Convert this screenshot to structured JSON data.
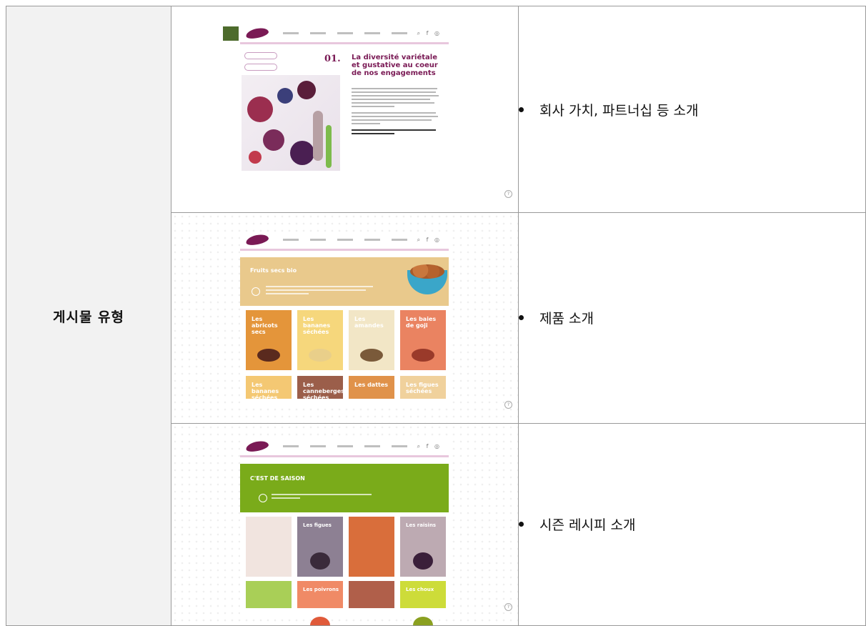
{
  "table": {
    "category_label": "게시물 유형",
    "rows": [
      {
        "description": "회사 가치, 파트너십 등 소개",
        "screenshot": {
          "number": "01.",
          "heading": "La diversité variétale et gustative au coeur de nos engagements"
        }
      },
      {
        "description": "제품 소개",
        "screenshot": {
          "banner_title": "Fruits secs bio",
          "cards": [
            {
              "label": "Les abricots secs",
              "color": "#e4953a"
            },
            {
              "label": "Les bananes séchées",
              "color": "#f6d77c"
            },
            {
              "label": "Les amandes",
              "color": "#f2e6c6"
            },
            {
              "label": "Les baies de goji",
              "color": "#ea8361"
            },
            {
              "label": "Les bananes séchées",
              "color": "#f4c873"
            },
            {
              "label": "Les canneberges séchées",
              "color": "#9b5e4a"
            },
            {
              "label": "Les dattes",
              "color": "#e0924a"
            },
            {
              "label": "Les figues séchées",
              "color": "#f0d19c"
            }
          ]
        }
      },
      {
        "description": "시즌 레시피 소개",
        "screenshot": {
          "banner_title": "C'EST DE SAISON",
          "tiles": [
            {
              "label": "",
              "color": "#f1e4df"
            },
            {
              "label": "Les figues",
              "color": "#8d8093"
            },
            {
              "label": "",
              "color": "#d96e3b"
            },
            {
              "label": "Les raisins",
              "color": "#bdaab2"
            },
            {
              "label": "",
              "color": "#a9cf57"
            },
            {
              "label": "Les poivrons",
              "color": "#f08a66"
            },
            {
              "label": "",
              "color": "#b05f4a"
            },
            {
              "label": "Les choux",
              "color": "#cddc39"
            }
          ]
        }
      }
    ]
  }
}
